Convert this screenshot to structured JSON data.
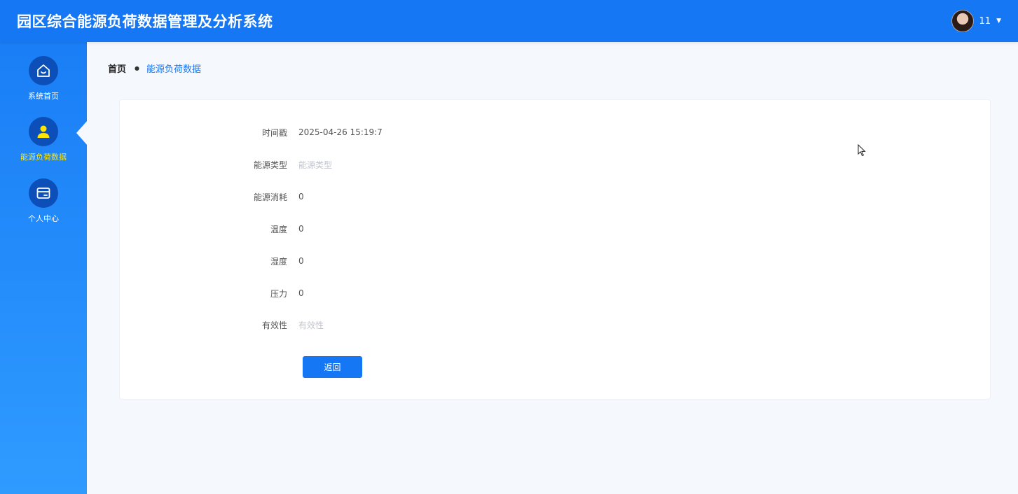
{
  "header": {
    "app_title": "园区综合能源负荷数据管理及分析系统",
    "username": "11"
  },
  "sidebar": {
    "items": [
      {
        "label": "系统首页",
        "icon": "home-icon",
        "active": false
      },
      {
        "label": "能源负荷数据",
        "icon": "user-icon",
        "active": true
      },
      {
        "label": "个人中心",
        "icon": "card-icon",
        "active": false
      }
    ]
  },
  "breadcrumb": {
    "home": "首页",
    "current": "能源负荷数据"
  },
  "form": {
    "fields": [
      {
        "label": "时间戳",
        "value": "2025-04-26 15:19:7",
        "placeholder": false
      },
      {
        "label": "能源类型",
        "value": "能源类型",
        "placeholder": true
      },
      {
        "label": "能源消耗",
        "value": "0",
        "placeholder": false
      },
      {
        "label": "温度",
        "value": "0",
        "placeholder": false
      },
      {
        "label": "湿度",
        "value": "0",
        "placeholder": false
      },
      {
        "label": "压力",
        "value": "0",
        "placeholder": false
      },
      {
        "label": "有效性",
        "value": "有效性",
        "placeholder": true
      }
    ],
    "back_label": "返回"
  },
  "colors": {
    "primary": "#1677f5",
    "active_nav": "#ffe500",
    "icon_circle": "#0d4fb8"
  }
}
